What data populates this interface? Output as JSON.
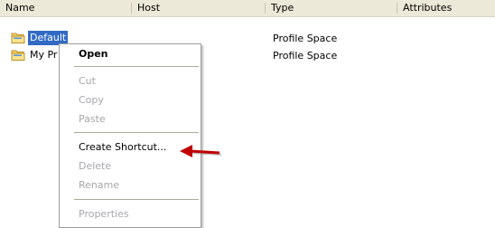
{
  "columns": [
    {
      "label": "Name"
    },
    {
      "label": "Host"
    },
    {
      "label": "Type"
    },
    {
      "label": "Attributes"
    }
  ],
  "rows": [
    {
      "name": "Default",
      "type": "Profile Space",
      "selected": true
    },
    {
      "name": "My Pr",
      "type": "Profile Space",
      "selected": false
    }
  ],
  "context_menu": {
    "open": "Open",
    "cut": "Cut",
    "copy": "Copy",
    "paste": "Paste",
    "create_shortcut": "Create Shortcut...",
    "delete": "Delete",
    "rename": "Rename",
    "properties": "Properties"
  },
  "colors": {
    "selection": "#316ac5",
    "arrow": "#c00000",
    "disabled_text": "#a7a6aa"
  },
  "icons": {
    "row_icon": "folder-icon",
    "pointer": "red-arrow-icon"
  }
}
